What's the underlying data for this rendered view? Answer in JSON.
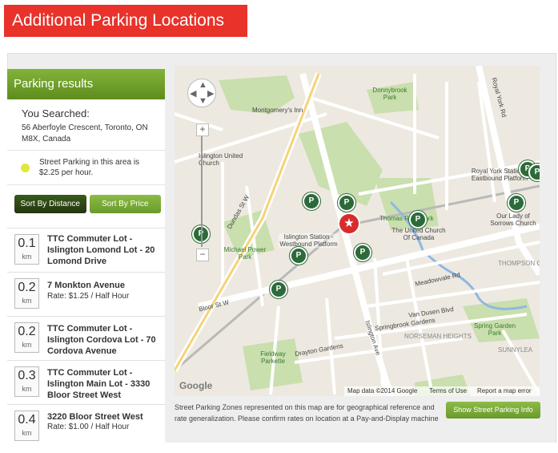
{
  "banner": {
    "title": "Additional Parking Locations"
  },
  "sidebar": {
    "header": "Parking results",
    "searched_label": "You Searched:",
    "address": "56 Aberfoyle Crescent, Toronto, ON M8X, Canada",
    "street_text": "Street Parking in this area is $2.25 per hour.",
    "sort_distance": "Sort By Distance",
    "sort_price": "Sort By Price"
  },
  "lots": [
    {
      "dist": "0.1",
      "unit": "km",
      "title": "TTC Commuter Lot - Islington Lomond Lot - 20 Lomond Drive",
      "rate": ""
    },
    {
      "dist": "0.2",
      "unit": "km",
      "title": "7 Monkton Avenue",
      "rate": "Rate: $1.25 / Half Hour"
    },
    {
      "dist": "0.2",
      "unit": "km",
      "title": "TTC Commuter Lot - Islington Cordova Lot - 70 Cordova Avenue",
      "rate": ""
    },
    {
      "dist": "0.3",
      "unit": "km",
      "title": "TTC Commuter Lot - Islington Main Lot - 3330 Bloor Street West",
      "rate": ""
    },
    {
      "dist": "0.4",
      "unit": "km",
      "title": "3220 Bloor Street West",
      "rate": "Rate: $1.00 / Half Hour"
    }
  ],
  "map": {
    "labels": [
      "Dundas St W",
      "Bloor St W",
      "Islington Ave",
      "Royal York Rd",
      "Montgomery's Inn",
      "Islington United Church",
      "Michael Power Park",
      "Islington Station - Westbound Platform",
      "The United Church Of Canada",
      "Thomas Riley Park",
      "Royal York Station - Eastbound Platform",
      "Our Lady of Sorrows Church",
      "THOMPSON ORCHARD",
      "NORSEMAN HEIGHTS",
      "SUNNYLEA",
      "Spring Garden Park",
      "Fieldway Parkette",
      "Donnybrook Park",
      "Meadowvale Rd",
      "Van Dusen Blvd",
      "Springbrook Gardens",
      "Drayton Gardens"
    ],
    "attribution": "Map data ©2014 Google",
    "terms": "Terms of Use",
    "report": "Report a map error",
    "google": "Google"
  },
  "footer": {
    "note": "Street Parking Zones represented on this map are for geographical reference and rate generalization. Please confirm rates on location at a Pay-and-Display machine",
    "show_button": "Show Street Parking Info"
  },
  "colors": {
    "banner": "#e8322a",
    "accent": "#6a9a2a",
    "dark": "#2d4617",
    "pin": "#2d6a3a"
  }
}
